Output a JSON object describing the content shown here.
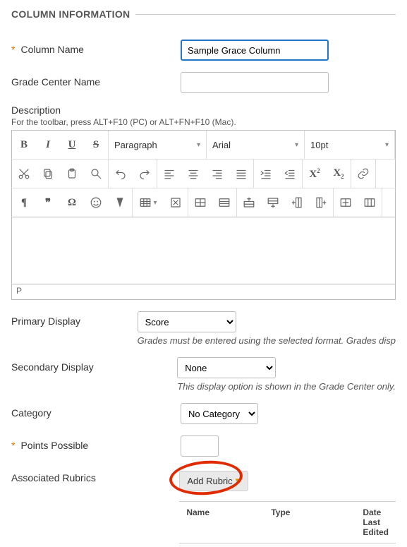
{
  "section_title": "COLUMN INFORMATION",
  "column_name": {
    "label": "Column Name",
    "value": "Sample Grace Column"
  },
  "grade_center_name": {
    "label": "Grade Center Name",
    "value": ""
  },
  "description": {
    "label": "Description",
    "hint": "For the toolbar, press ALT+F10 (PC) or ALT+FN+F10 (Mac).",
    "format_label": "Paragraph",
    "font_label": "Arial",
    "size_label": "10pt",
    "status_path": "P"
  },
  "primary_display": {
    "label": "Primary Display",
    "value": "Score",
    "help": "Grades must be entered using the selected format. Grades disp"
  },
  "secondary_display": {
    "label": "Secondary Display",
    "value": "None",
    "help": "This display option is shown in the Grade Center only."
  },
  "category": {
    "label": "Category",
    "value": "No Category"
  },
  "points_possible": {
    "label": "Points Possible",
    "value": ""
  },
  "rubrics": {
    "label": "Associated Rubrics",
    "add_button": "Add Rubric",
    "columns": {
      "name": "Name",
      "type": "Type",
      "date": "Date Last Edited"
    }
  }
}
